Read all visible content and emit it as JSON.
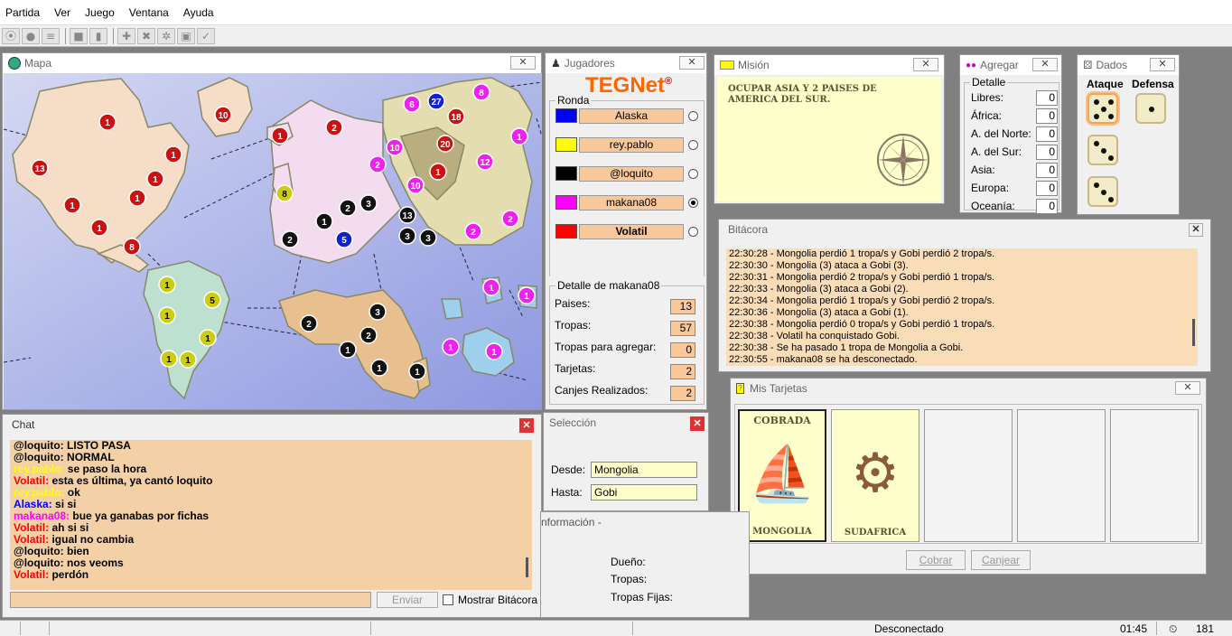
{
  "menu": [
    "Partida",
    "Ver",
    "Juego",
    "Ventana",
    "Ayuda"
  ],
  "map": {
    "title": "Mapa",
    "water_color": "#a8b4e8",
    "territories": [
      {
        "owner": "red",
        "armies": "1"
      },
      {
        "owner": "red",
        "armies": "10"
      },
      {
        "owner": "red",
        "armies": "13"
      },
      {
        "owner": "red",
        "armies": "1"
      },
      {
        "owner": "red",
        "armies": "1"
      },
      {
        "owner": "red",
        "armies": "1"
      },
      {
        "owner": "red",
        "armies": "1"
      },
      {
        "owner": "red",
        "armies": "1"
      },
      {
        "owner": "red",
        "armies": "8"
      },
      {
        "owner": "red",
        "armies": "1"
      },
      {
        "owner": "red",
        "armies": "2"
      },
      {
        "owner": "yellow",
        "armies": "8"
      },
      {
        "owner": "yellow",
        "armies": "1"
      },
      {
        "owner": "yellow",
        "armies": "5"
      },
      {
        "owner": "yellow",
        "armies": "1"
      },
      {
        "owner": "yellow",
        "armies": "1"
      },
      {
        "owner": "yellow",
        "armies": "1"
      },
      {
        "owner": "yellow",
        "armies": "1"
      },
      {
        "owner": "magenta",
        "armies": "2"
      },
      {
        "owner": "magenta",
        "armies": "10"
      },
      {
        "owner": "magenta",
        "armies": "6"
      },
      {
        "owner": "blue",
        "armies": "27"
      },
      {
        "owner": "magenta",
        "armies": "8"
      },
      {
        "owner": "red",
        "armies": "18"
      },
      {
        "owner": "red",
        "armies": "20"
      },
      {
        "owner": "red",
        "armies": "1"
      },
      {
        "owner": "magenta",
        "armies": "12"
      },
      {
        "owner": "magenta",
        "armies": "1"
      },
      {
        "owner": "magenta",
        "armies": "10"
      },
      {
        "owner": "black",
        "armies": "3"
      },
      {
        "owner": "black",
        "armies": "2"
      },
      {
        "owner": "black",
        "armies": "1"
      },
      {
        "owner": "black",
        "armies": "2"
      },
      {
        "owner": "blue",
        "armies": "5"
      },
      {
        "owner": "black",
        "armies": "13"
      },
      {
        "owner": "black",
        "armies": "3"
      },
      {
        "owner": "black",
        "armies": "3"
      },
      {
        "owner": "magenta",
        "armies": "2"
      },
      {
        "owner": "magenta",
        "armies": "2"
      },
      {
        "owner": "black",
        "armies": "2"
      },
      {
        "owner": "black",
        "armies": "3"
      },
      {
        "owner": "black",
        "armies": "2"
      },
      {
        "owner": "black",
        "armies": "1"
      },
      {
        "owner": "black",
        "armies": "1"
      },
      {
        "owner": "black",
        "armies": "1"
      },
      {
        "owner": "magenta",
        "armies": "1"
      },
      {
        "owner": "magenta",
        "armies": "1"
      },
      {
        "owner": "magenta",
        "armies": "1"
      },
      {
        "owner": "magenta",
        "armies": "1"
      }
    ]
  },
  "players": {
    "title": "Jugadores",
    "logo": "TEGNet",
    "logo_mark": "®",
    "round_label": "Ronda",
    "list": [
      {
        "name": "Alaska",
        "color": "#0000ff",
        "bold": false,
        "selected": false
      },
      {
        "name": "rey.pablo",
        "color": "#ffff00",
        "bold": false,
        "selected": false
      },
      {
        "name": "@loquito",
        "color": "#000000",
        "bold": false,
        "selected": false
      },
      {
        "name": "makana08",
        "color": "#ff00ff",
        "bold": false,
        "selected": true
      },
      {
        "name": "Volatil",
        "color": "#ff0000",
        "bold": true,
        "selected": false
      }
    ],
    "detail_title": "Detalle de makana08",
    "details": [
      {
        "label": "Paises:",
        "value": "13"
      },
      {
        "label": "Tropas:",
        "value": "57"
      },
      {
        "label": "Tropas para agregar:",
        "value": "0"
      },
      {
        "label": "Tarjetas:",
        "value": "2"
      },
      {
        "label": "Canjes Realizados:",
        "value": "2"
      }
    ]
  },
  "mission": {
    "title": "Misión",
    "text": "OCUPAR ASIA Y 2 PAISES DE AMERICA DEL SUR."
  },
  "agregar": {
    "title": "Agregar",
    "group": "Detalle",
    "rows": [
      {
        "label": "Libres:",
        "value": "0"
      },
      {
        "label": "África:",
        "value": "0"
      },
      {
        "label": "A. del Norte:",
        "value": "0"
      },
      {
        "label": "A. del Sur:",
        "value": "0"
      },
      {
        "label": "Asia:",
        "value": "0"
      },
      {
        "label": "Europa:",
        "value": "0"
      },
      {
        "label": "Oceanía:",
        "value": "0"
      }
    ]
  },
  "dice": {
    "title": "Dados",
    "attack_label": "Ataque",
    "defense_label": "Defensa",
    "attack": [
      5,
      3,
      3
    ],
    "defense": [
      1
    ]
  },
  "log": {
    "title": "Bitácora",
    "lines": [
      "22:30:28 - Mongolia perdió 1 tropa/s y Gobi perdió 2 tropa/s.",
      "22:30:30 - Mongolia (3) ataca a Gobi (3).",
      "22:30:31 - Mongolia perdió 2 tropa/s y Gobi perdió 1 tropa/s.",
      "22:30:33 - Mongolia (3) ataca a Gobi (2).",
      "22:30:34 - Mongolia perdió 1 tropa/s y Gobi perdió 2 tropa/s.",
      "22:30:36 - Mongolia (3) ataca a Gobi (1).",
      "22:30:38 - Mongolia perdió 0 tropa/s y Gobi perdió 1 tropa/s.",
      "22:30:38 - Volatil ha conquistado Gobi.",
      "22:30:38 - Se ha pasado 1 tropa de Mongolia a Gobi.",
      "22:30:55 - makana08 se ha desconectado."
    ]
  },
  "cards": {
    "title": "Mis Tarjetas",
    "items": [
      {
        "top": "COBRADA",
        "name": "MONGOLIA",
        "symbol": "ship-icon"
      },
      {
        "top": "",
        "name": "SUDAFRICA",
        "symbol": "cannon-icon"
      }
    ],
    "collect_label": "Cobrar",
    "exchange_label": "Canjear"
  },
  "chat": {
    "title": "Chat",
    "messages": [
      {
        "user": "@loquito",
        "color": "#000000",
        "text": "LISTO PASA"
      },
      {
        "user": "@loquito",
        "color": "#000000",
        "text": "NORMAL"
      },
      {
        "user": "rey.pablo",
        "color": "#ffff00",
        "text": "se paso la hora"
      },
      {
        "user": "Volatil",
        "color": "#ff0000",
        "text": "esta es última, ya cantó loquito"
      },
      {
        "user": "rey.pablo",
        "color": "#ffff00",
        "text": "ok"
      },
      {
        "user": "Alaska",
        "color": "#0000ff",
        "text": "si si"
      },
      {
        "user": "makana08",
        "color": "#ff00ff",
        "text": "bue ya ganabas por fichas"
      },
      {
        "user": "Volatil",
        "color": "#ff0000",
        "text": "ah si si"
      },
      {
        "user": "Volatil",
        "color": "#ff0000",
        "text": "igual no cambia"
      },
      {
        "user": "@loquito",
        "color": "#000000",
        "text": "bien"
      },
      {
        "user": "@loquito",
        "color": "#000000",
        "text": "nos veoms"
      },
      {
        "user": "Volatil",
        "color": "#ff0000",
        "text": "perdón"
      }
    ],
    "send_label": "Enviar",
    "show_log_label": "Mostrar Bitácora"
  },
  "selection": {
    "title": "Selección",
    "from_label": "Desde:",
    "from_value": "Mongolia",
    "to_label": "Hasta:",
    "to_value": "Gobi"
  },
  "info": {
    "title": "nformación -",
    "owner_label": "Dueño:",
    "troops_label": "Tropas:",
    "fixed_label": "Tropas Fijas:"
  },
  "status": {
    "text": "Desconectado",
    "time": "01:45",
    "count": "181"
  },
  "colors": {
    "panel_fill": "#f3d0a6",
    "mission_bg": "#ffffcc",
    "red": "#cc1111",
    "yellow": "#cccc11",
    "black": "#111111",
    "magenta": "#ee22ee",
    "blue": "#1122cc"
  }
}
